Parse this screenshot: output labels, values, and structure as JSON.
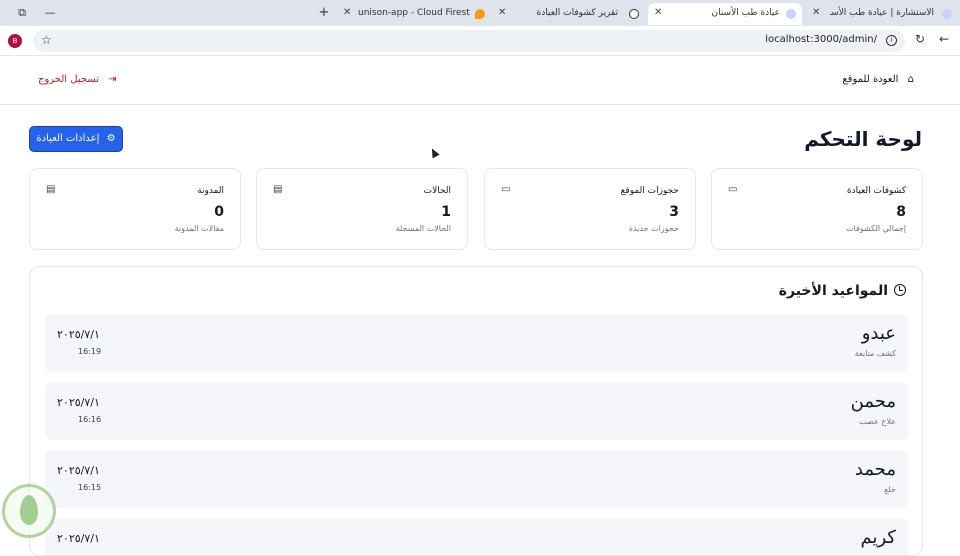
{
  "browser": {
    "tabs": [
      {
        "title": "الاستشارة | عيادة طب الأسنان",
        "active": false,
        "favicon": "clinic-favicon"
      },
      {
        "title": "عيادة طب الأسنان",
        "active": true,
        "favicon": "clinic-favicon"
      },
      {
        "title": "تقرير كشوفات العيادة",
        "active": false,
        "favicon": "globe-favicon"
      },
      {
        "title": "unison-app - Cloud Firestore",
        "active": false,
        "favicon": "firebase-favicon"
      }
    ],
    "new_tab": "+",
    "close_glyph": "✕",
    "profile_initial": "B",
    "url": "localhost:3000/admin/",
    "colors": {
      "tabstrip": "#dfe3eb",
      "profile": "#b0123b"
    }
  },
  "header": {
    "logout_label": "تسجيل الخروج",
    "logout_icon": "logout-icon",
    "back_label": "العودة للموقع",
    "back_icon": "home-icon"
  },
  "page": {
    "title": "لوحة التحكم",
    "clinic_settings_label": "إعدادات العيادة",
    "clinic_settings_icon": "gear-icon",
    "accent": "#2563eb"
  },
  "stats": [
    {
      "title": "كشوفات العيادة",
      "value": "8",
      "subtitle": "إجمالي الكشوفات",
      "icon": "calendar-icon"
    },
    {
      "title": "حجوزات الموقع",
      "value": "3",
      "subtitle": "حجوزات جديدة",
      "icon": "calendar-icon"
    },
    {
      "title": "الحالات",
      "value": "1",
      "subtitle": "الحالات المسجلة",
      "icon": "document-icon"
    },
    {
      "title": "المدونة",
      "value": "0",
      "subtitle": "مقالات المدونة",
      "icon": "document-icon"
    }
  ],
  "recent": {
    "title": "المواعيد الأخيرة",
    "icon": "clock-icon",
    "items": [
      {
        "name": "عبدو",
        "type": "كشف متابعة",
        "date": "٢٠٢٥/٧/١",
        "time": "16:19"
      },
      {
        "name": "محمن",
        "type": "علاج عصب",
        "date": "٢٠٢٥/٧/١",
        "time": "16:16"
      },
      {
        "name": "محمد",
        "type": "خلع",
        "date": "٢٠٢٥/٧/١",
        "time": "16:15"
      },
      {
        "name": "كريم",
        "type": "",
        "date": "٢٠٢٥/٧/١",
        "time": ""
      }
    ]
  }
}
